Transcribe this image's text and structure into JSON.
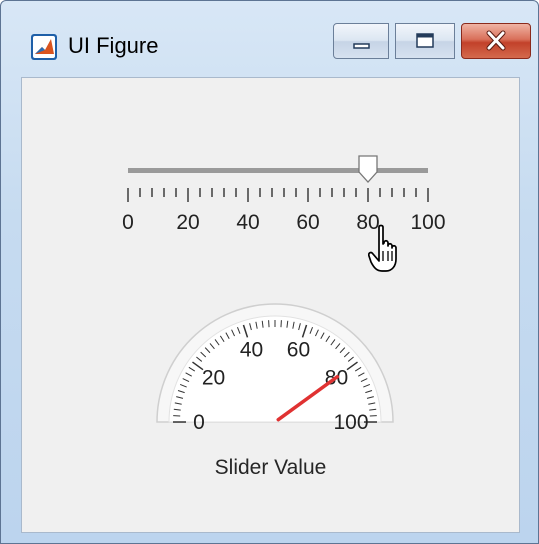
{
  "window": {
    "title": "UI Figure",
    "buttons": {
      "minimize": "minimize-icon",
      "maximize": "maximize-icon",
      "close": "close-icon"
    }
  },
  "slider": {
    "min": 0,
    "max": 100,
    "value": 80,
    "major_ticks": [
      "0",
      "20",
      "40",
      "60",
      "80",
      "100"
    ],
    "minor_step": 4
  },
  "gauge": {
    "min": 0,
    "max": 100,
    "value": 80,
    "tick_labels": [
      "0",
      "20",
      "40",
      "60",
      "80",
      "100"
    ],
    "label": "Slider Value",
    "needle_color": "#e03232"
  },
  "cursor": {
    "icon": "hand-pointer-icon"
  },
  "colors": {
    "frame": "#c6dbf0",
    "panel": "#f0f0f0",
    "close": "#c2412a"
  }
}
